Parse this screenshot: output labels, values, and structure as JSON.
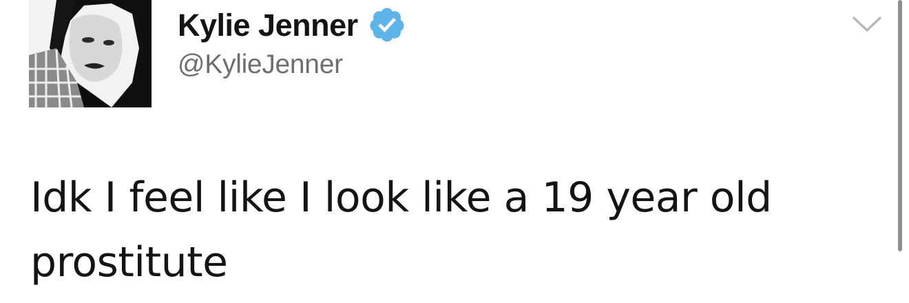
{
  "tweet": {
    "display_name": "Kylie Jenner",
    "handle": "@KylieJenner",
    "verified": true,
    "text": "Idk I feel like I look like a 19 year old prostitute",
    "icons": {
      "verified": "verified-badge-icon",
      "menu": "chevron-down-icon"
    },
    "colors": {
      "verified_badge": "#5eb3e8",
      "name": "#141414",
      "handle": "#6e6e6e"
    }
  }
}
